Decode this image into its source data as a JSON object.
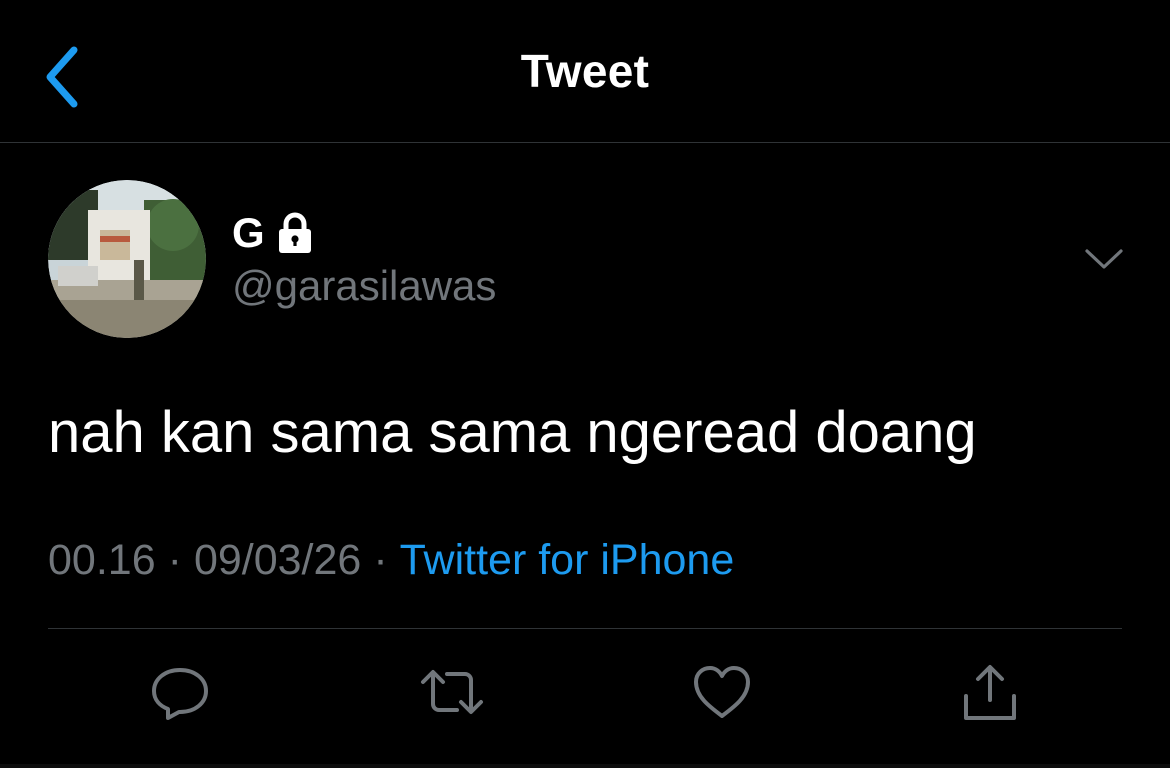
{
  "header": {
    "title": "Tweet"
  },
  "author": {
    "name": "G",
    "handle": "@garasilawas"
  },
  "tweet": {
    "text": "nah kan sama sama ngeread doang"
  },
  "meta": {
    "time": "00.16",
    "date": "09/03/26",
    "source": "Twitter for iPhone",
    "separator": "·"
  },
  "colors": {
    "accent": "#1d9bf0",
    "muted": "#71767b",
    "background": "#000000",
    "divider": "#2f3336"
  },
  "icons": {
    "back": "chevron-left-icon",
    "lock": "lock-icon",
    "more": "chevron-down-icon",
    "reply": "reply-icon",
    "retweet": "retweet-icon",
    "like": "heart-icon",
    "share": "share-icon"
  }
}
